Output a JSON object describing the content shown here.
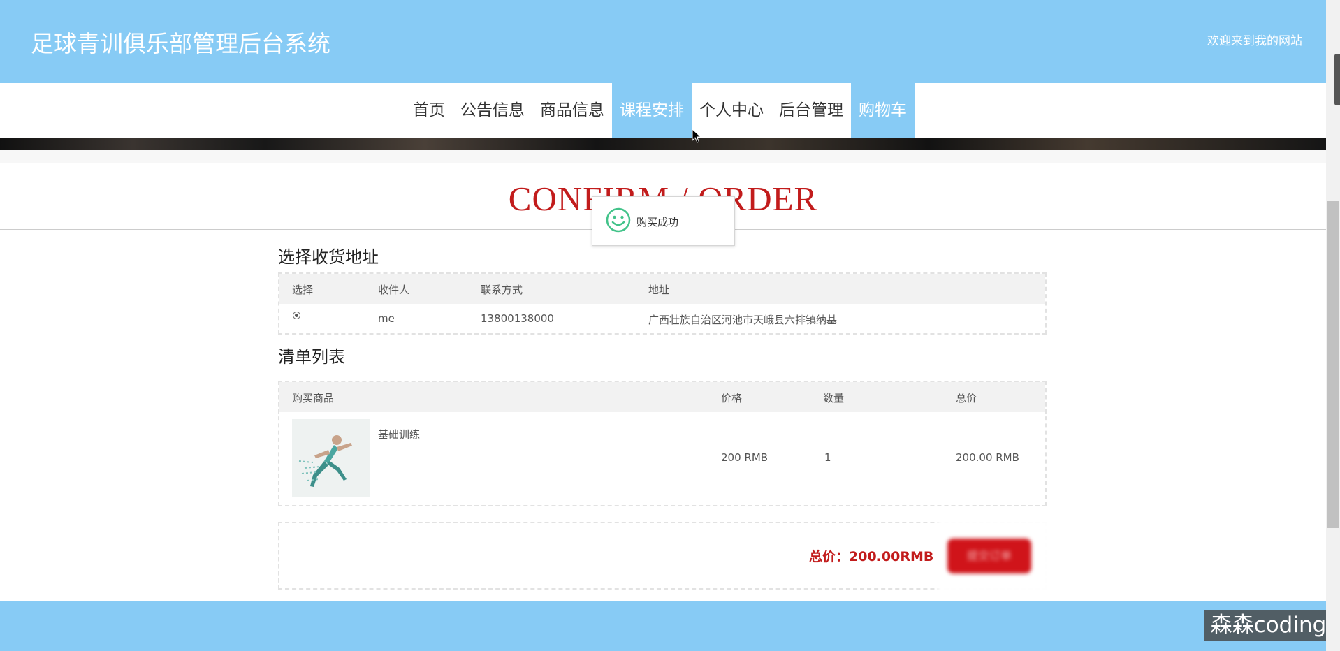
{
  "header": {
    "site_title": "足球青训俱乐部管理后台系统",
    "welcome": "欢迎来到我的网站"
  },
  "nav": {
    "items": [
      {
        "label": "首页",
        "active": false
      },
      {
        "label": "公告信息",
        "active": false
      },
      {
        "label": "商品信息",
        "active": false
      },
      {
        "label": "课程安排",
        "active": true
      },
      {
        "label": "个人中心",
        "active": false
      },
      {
        "label": "后台管理",
        "active": false
      },
      {
        "label": "购物车",
        "active": true
      }
    ]
  },
  "page": {
    "title": "CONFIRM / ORDER"
  },
  "toast": {
    "icon": "smile-icon",
    "message": "购买成功"
  },
  "address_section": {
    "title": "选择收货地址",
    "columns": [
      "选择",
      "收件人",
      "联系方式",
      "地址"
    ],
    "rows": [
      {
        "selected": true,
        "recipient": "me",
        "phone": "13800138000",
        "address": "广西壮族自治区河池市天峨县六排镇纳基"
      }
    ]
  },
  "list_section": {
    "title": "清单列表",
    "columns": [
      "购买商品",
      "价格",
      "数量",
      "总价"
    ],
    "rows": [
      {
        "product": "基础训练",
        "price": "200 RMB",
        "quantity": "1",
        "total": "200.00 RMB"
      }
    ]
  },
  "summary": {
    "total_label": "总价：200.00RMB",
    "submit_label": "提交订单"
  },
  "watermark": "森森coding",
  "colors": {
    "header_bg": "#87cbf5",
    "accent_red": "#c21c1c",
    "button_red": "#d0141a"
  }
}
